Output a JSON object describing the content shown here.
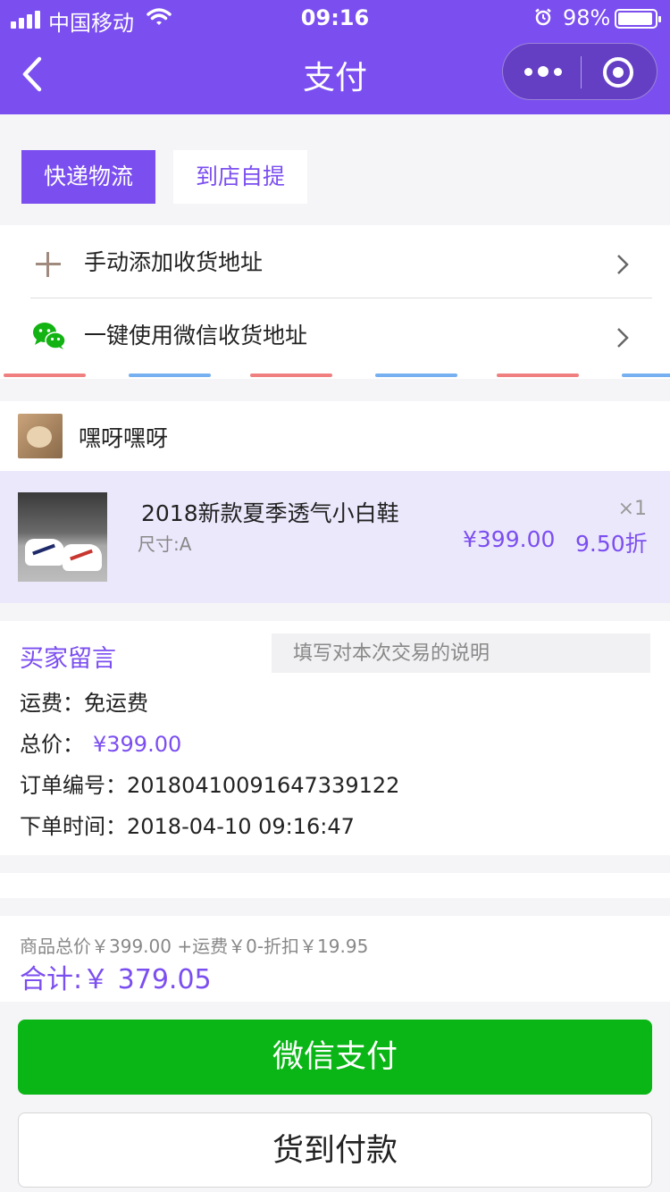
{
  "status_bar": {
    "carrier": "中国移动",
    "time": "09:16",
    "battery": "98%",
    "battery_level": 0.98
  },
  "nav": {
    "title": "支付"
  },
  "delivery": {
    "tabs": [
      {
        "label": "快递物流",
        "active": true
      },
      {
        "label": "到店自提",
        "active": false
      }
    ]
  },
  "address": {
    "manual_label": "手动添加收货地址",
    "wechat_label": "一键使用微信收货地址"
  },
  "shop": {
    "name": "嘿呀嘿呀"
  },
  "product": {
    "title": "2018新款夏季透气小白鞋",
    "size": "尺寸:A",
    "quantity": "×1",
    "price": "¥399.00",
    "discount": "9.50折"
  },
  "order": {
    "message_label": "买家留言",
    "message_placeholder": "填写对本次交易的说明",
    "shipping_label": "运费：",
    "shipping_value": "免运费",
    "total_label": "总价：",
    "total_value": "¥399.00",
    "order_no_label": "订单编号：",
    "order_no_value": "20180410091647339122",
    "order_time_label": "下单时间：",
    "order_time_value": "2018-04-10 09:16:47"
  },
  "summary": {
    "detail": "商品总价￥399.00 +运费￥0-折扣￥19.95",
    "total": "合计:￥ 379.05"
  },
  "actions": {
    "wechat_pay": "微信支付",
    "cash_on_delivery": "货到付款"
  },
  "colors": {
    "brand": "#7b4ef0",
    "pay_green": "#0ab516"
  }
}
